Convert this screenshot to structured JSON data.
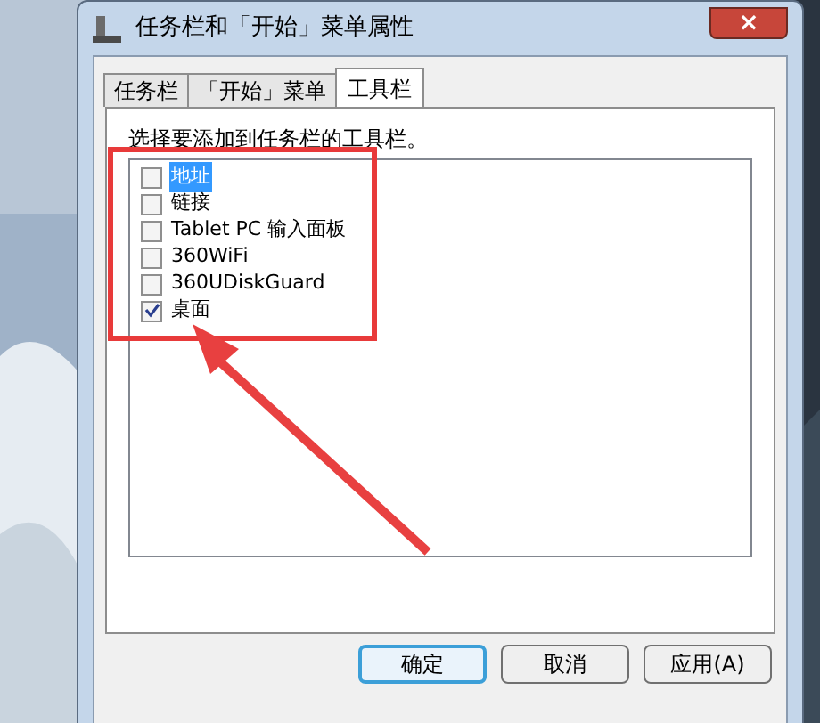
{
  "window": {
    "title": "任务栏和「开始」菜单属性",
    "close": "×"
  },
  "tabs": [
    {
      "label": "任务栏",
      "selected": false
    },
    {
      "label": "「开始」菜单",
      "selected": false
    },
    {
      "label": "工具栏",
      "selected": true
    }
  ],
  "instruction": "选择要添加到任务栏的工具栏。",
  "toolbars": [
    {
      "label": "地址",
      "checked": false,
      "selected": true
    },
    {
      "label": "链接",
      "checked": false,
      "selected": false
    },
    {
      "label": "Tablet PC 输入面板",
      "checked": false,
      "selected": false
    },
    {
      "label": "360WiFi",
      "checked": false,
      "selected": false
    },
    {
      "label": "360UDiskGuard",
      "checked": false,
      "selected": false
    },
    {
      "label": "桌面",
      "checked": true,
      "selected": false
    }
  ],
  "buttons": [
    {
      "label": "确定",
      "default": true
    },
    {
      "label": "取消",
      "default": false
    },
    {
      "label": "应用(A)",
      "default": false
    }
  ]
}
